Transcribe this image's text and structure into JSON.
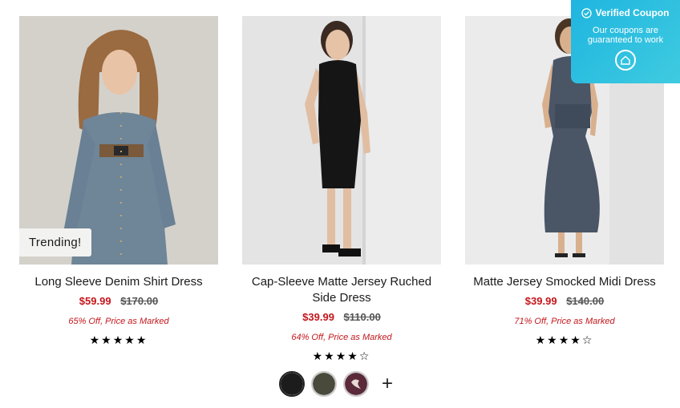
{
  "products": [
    {
      "name": "Long Sleeve Denim Shirt Dress",
      "sale_price": "$59.99",
      "original_price": "$170.00",
      "discount": "65% Off, Price as Marked",
      "badge": "Trending!",
      "rating": 5,
      "stars": "★★★★★"
    },
    {
      "name": "Cap-Sleeve Matte Jersey Ruched Side Dress",
      "sale_price": "$39.99",
      "original_price": "$110.00",
      "discount": "64% Off, Price as Marked",
      "rating": 4,
      "stars": "★★★★☆"
    },
    {
      "name": "Matte Jersey Smocked Midi Dress",
      "sale_price": "$39.99",
      "original_price": "$140.00",
      "discount": "71% Off, Price as Marked",
      "rating": 4,
      "stars": "★★★★☆"
    }
  ],
  "swatches": {
    "colors": [
      "#1c1c1c",
      "#4a4a3c",
      "#5a2a3a"
    ],
    "more_label": "+"
  },
  "coupon": {
    "title": "Verified Coupon",
    "subtitle": "Our coupons are guaranteed to work",
    "color": "#29bfe2"
  },
  "colors": {
    "sale_price": "#c4161c",
    "stars": "#000000"
  }
}
